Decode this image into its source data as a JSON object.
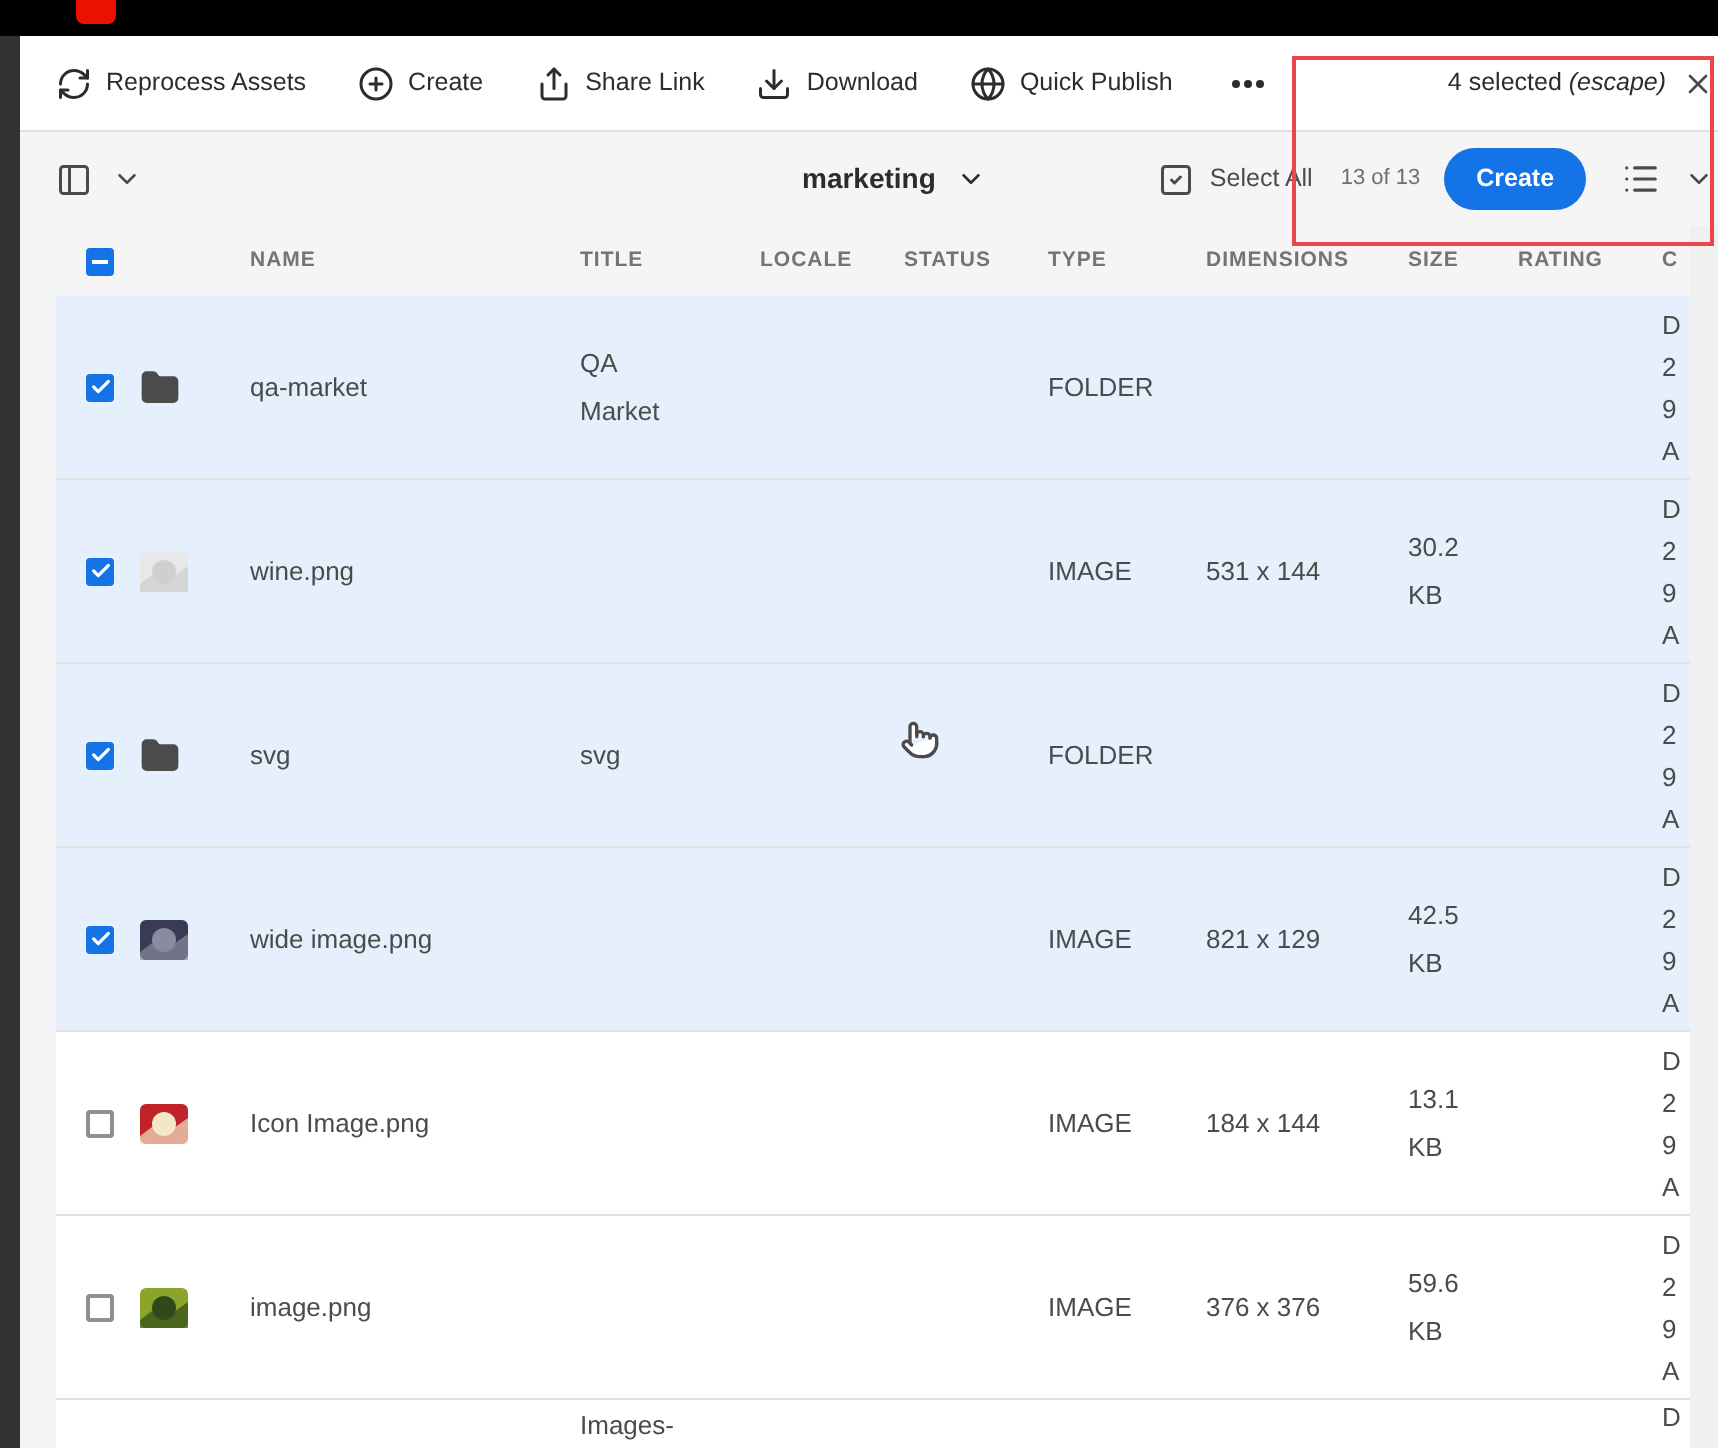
{
  "actions": [
    {
      "kind": "reprocess",
      "label": "Reprocess Assets"
    },
    {
      "kind": "create",
      "label": "Create"
    },
    {
      "kind": "share",
      "label": "Share Link"
    },
    {
      "kind": "download",
      "label": "Download"
    },
    {
      "kind": "publish",
      "label": "Quick Publish"
    },
    {
      "kind": "more"
    }
  ],
  "selection": {
    "count_text": "4 selected",
    "hint": "(escape)"
  },
  "browser_bar": {
    "folder": "marketing",
    "select_all": "Select All",
    "count": "13 of 13",
    "create": "Create"
  },
  "table": {
    "some_selected": true,
    "columns": [
      "NAME",
      "TITLE",
      "LOCALE",
      "STATUS",
      "TYPE",
      "DIMENSIONS",
      "SIZE",
      "RATING",
      "C"
    ],
    "rows": [
      {
        "selected": true,
        "kind": "folder",
        "name": "qa-market",
        "title": "QA Market",
        "type": "FOLDER",
        "column_9": [
          "D",
          "2",
          "9",
          "A"
        ]
      },
      {
        "selected": true,
        "name": "wine.png",
        "type": "IMAGE",
        "dimensions": "531 x 144",
        "size": "30.2 KB",
        "column_9": [
          "D",
          "2",
          "9",
          "A"
        ]
      },
      {
        "selected": true,
        "kind": "folder",
        "name": "svg",
        "title": "svg",
        "type": "FOLDER",
        "column_9": [
          "D",
          "2",
          "9",
          "A"
        ]
      },
      {
        "selected": true,
        "name": "wide image.png",
        "type": "IMAGE",
        "dimensions": "821 x 129",
        "size": "42.5 KB",
        "column_9": [
          "D",
          "2",
          "9",
          "A"
        ]
      },
      {
        "selected": false,
        "name": "Icon Image.png",
        "type": "IMAGE",
        "dimensions": "184 x 144",
        "size": "13.1 KB",
        "column_9": [
          "D",
          "2",
          "9",
          "A"
        ]
      },
      {
        "selected": false,
        "name": "image.png",
        "type": "IMAGE",
        "dimensions": "376 x 376",
        "size": "59.6 KB",
        "column_9": [
          "D",
          "2",
          "9",
          "A"
        ]
      },
      {
        "selected": false,
        "clipped": true,
        "title": "Images-",
        "column_9": [
          "D"
        ]
      }
    ]
  }
}
